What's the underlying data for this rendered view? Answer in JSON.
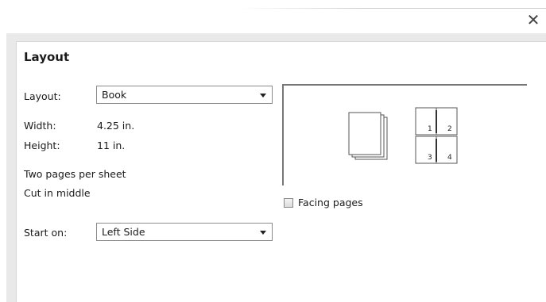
{
  "window": {
    "close_glyph": "✕"
  },
  "panel": {
    "title": "Layout"
  },
  "form": {
    "layout_label": "Layout:",
    "layout_value": "Book",
    "width_label": "Width:",
    "width_value": "4.25 in.",
    "height_label": "Height:",
    "height_value": "11 in.",
    "info_line1": "Two pages per sheet",
    "info_line2": "Cut in middle",
    "start_label": "Start on:",
    "start_value": "Left Side"
  },
  "preview": {
    "page_numbers": [
      "1",
      "2",
      "3",
      "4"
    ]
  },
  "facing_pages": {
    "label": "Facing pages",
    "checked": false
  }
}
